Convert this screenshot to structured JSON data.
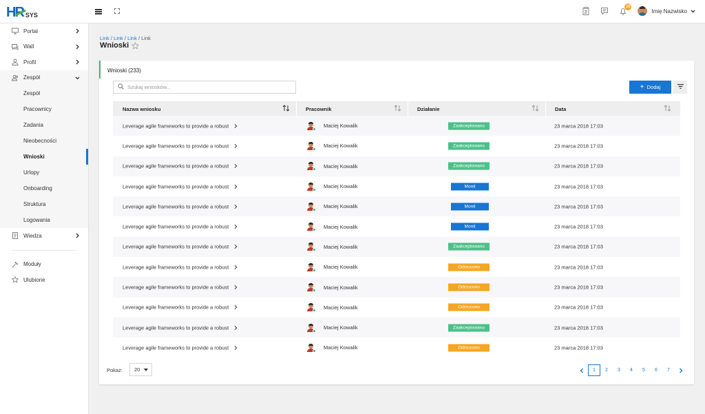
{
  "app": {
    "logo_main": "HR",
    "logo_sub": "SYS"
  },
  "header": {
    "notification_count": "10",
    "user_name": "Imię Nazwisko"
  },
  "sidebar": {
    "items": [
      {
        "label": "Portal"
      },
      {
        "label": "Wall"
      },
      {
        "label": "Profil"
      },
      {
        "label": "Zespół"
      }
    ],
    "subitems": [
      {
        "label": "Zespół"
      },
      {
        "label": "Pracownicy"
      },
      {
        "label": "Zadania"
      },
      {
        "label": "Nieobecności"
      },
      {
        "label": "Wnioski"
      },
      {
        "label": "Urlopy"
      },
      {
        "label": "Onboarding"
      },
      {
        "label": "Struktura"
      },
      {
        "label": "Logowania"
      }
    ],
    "wiedza": "Wiedza",
    "moduly": "Moduły",
    "ulubione": "Ulubione"
  },
  "breadcrumb": {
    "items": [
      "Link",
      "Link",
      "Link"
    ],
    "current": "Link",
    "separator": "/"
  },
  "page": {
    "title": "Wnioski"
  },
  "card": {
    "title": "Wnioski (233)",
    "search_placeholder": "Szukaj wniosków...",
    "add_label": "Dodaj"
  },
  "table": {
    "headers": {
      "name": "Nazwa wniosku",
      "employee": "Pracownik",
      "action": "Działanie",
      "date": "Data"
    },
    "rows": [
      {
        "name": "Leverage agile frameworks to provide a robust",
        "employee": "Maciej Kowalik",
        "status": "Zaakceptowano",
        "status_type": "green",
        "date": "23 marca 2018 17:03"
      },
      {
        "name": "Leverage agile frameworks to provide a robust",
        "employee": "Maciej Kowalik",
        "status": "Zaakceptowano",
        "status_type": "green",
        "date": "23 marca 2018 17:03"
      },
      {
        "name": "Leverage agile frameworks to provide a robust",
        "employee": "Maciej Kowalik",
        "status": "Zaakceptowano",
        "status_type": "green",
        "date": "23 marca 2018 17:03"
      },
      {
        "name": "Leverage agile frameworks to provide a robust",
        "employee": "Maciej Kowalik",
        "status": "Monit",
        "status_type": "blue",
        "date": "23 marca 2018 17:03"
      },
      {
        "name": "Leverage agile frameworks to provide a robust",
        "employee": "Maciej Kowalik",
        "status": "Monit",
        "status_type": "blue",
        "date": "23 marca 2018 17:03"
      },
      {
        "name": "Leverage agile frameworks to provide a robust",
        "employee": "Maciej Kowalik",
        "status": "Monit",
        "status_type": "blue",
        "date": "23 marca 2018 17:03"
      },
      {
        "name": "Leverage agile frameworks to provide a robust",
        "employee": "Maciej Kowalik",
        "status": "Zaakceptowano",
        "status_type": "green",
        "date": "23 marca 2018 17:03"
      },
      {
        "name": "Leverage agile frameworks to provide a robust",
        "employee": "Maciej Kowalik",
        "status": "Odrzucono",
        "status_type": "orange",
        "date": "23 marca 2018 17:03"
      },
      {
        "name": "Leverage agile frameworks to provide a robust",
        "employee": "Maciej Kowalik",
        "status": "Odrzucono",
        "status_type": "orange",
        "date": "23 marca 2018 17:03"
      },
      {
        "name": "Leverage agile frameworks to provide a robust",
        "employee": "Maciej Kowalik",
        "status": "Odrzucono",
        "status_type": "orange",
        "date": "23 marca 2018 17:03"
      },
      {
        "name": "Leverage agile frameworks to provide a robust",
        "employee": "Maciej Kowalik",
        "status": "Zaakceptowano",
        "status_type": "green",
        "date": "23 marca 2018 17:03"
      },
      {
        "name": "Leverage agile frameworks to provide a robust",
        "employee": "Maciej Kowalik",
        "status": "Odrzucono",
        "status_type": "orange",
        "date": "23 marca 2018 17:03"
      }
    ]
  },
  "footer": {
    "show_label": "Pokaż:",
    "page_size": "20",
    "pages": [
      "1",
      "2",
      "3",
      "4",
      "5",
      "6",
      "7"
    ],
    "current_page": "1"
  },
  "colors": {
    "accent": "#1976d2",
    "green": "#4cc088",
    "orange": "#f5a623",
    "card_accent": "#4caf7f"
  }
}
